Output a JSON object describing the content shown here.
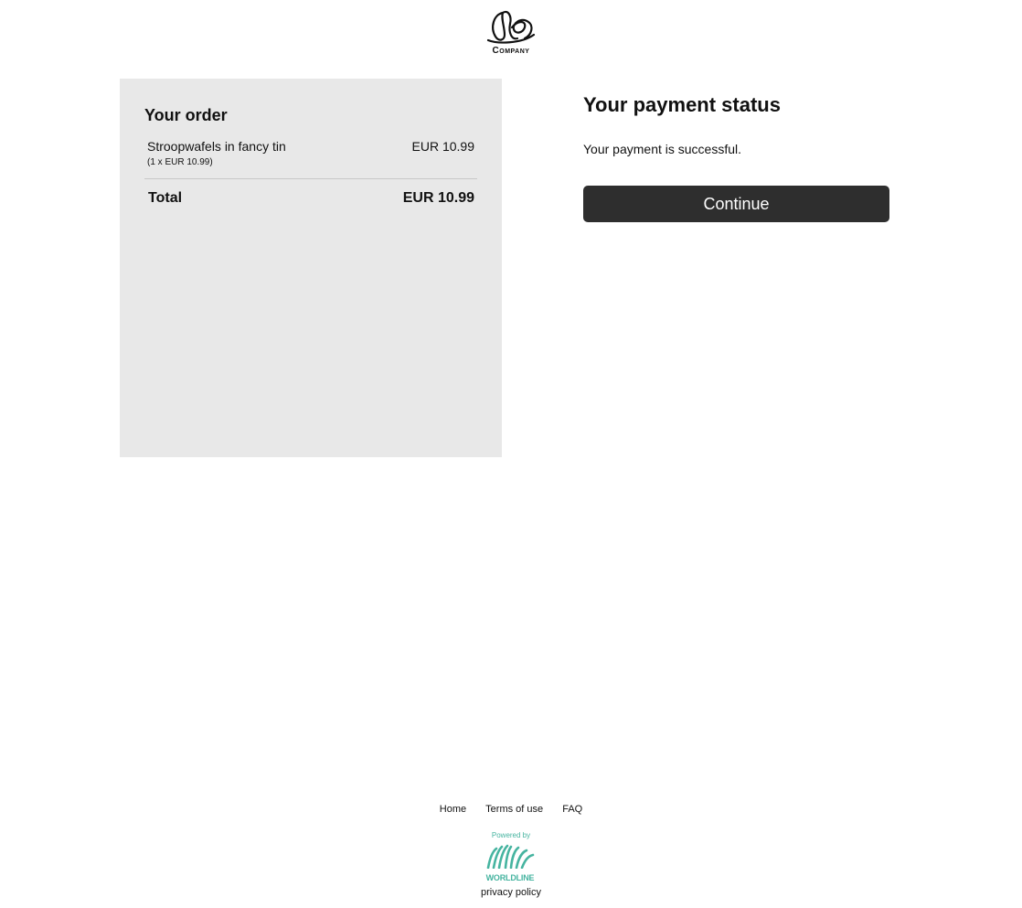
{
  "header": {
    "logo_text": "Company"
  },
  "order": {
    "title": "Your order",
    "item_name": "Stroopwafels in fancy tin",
    "item_price": "EUR 10.99",
    "item_qty": "(1 x EUR 10.99)",
    "total_label": "Total",
    "total_value": "EUR 10.99"
  },
  "status": {
    "title": "Your payment status",
    "message": "Your payment is successful.",
    "continue_label": "Continue"
  },
  "footer": {
    "links": [
      "Home",
      "Terms of use",
      "FAQ"
    ],
    "powered_by": "Powered by",
    "brand": "WORLDLINE",
    "privacy": "privacy policy"
  },
  "colors": {
    "panel_bg": "#e8e8e8",
    "button_bg": "#2e2e2e",
    "brand_teal": "#46b4a0"
  }
}
